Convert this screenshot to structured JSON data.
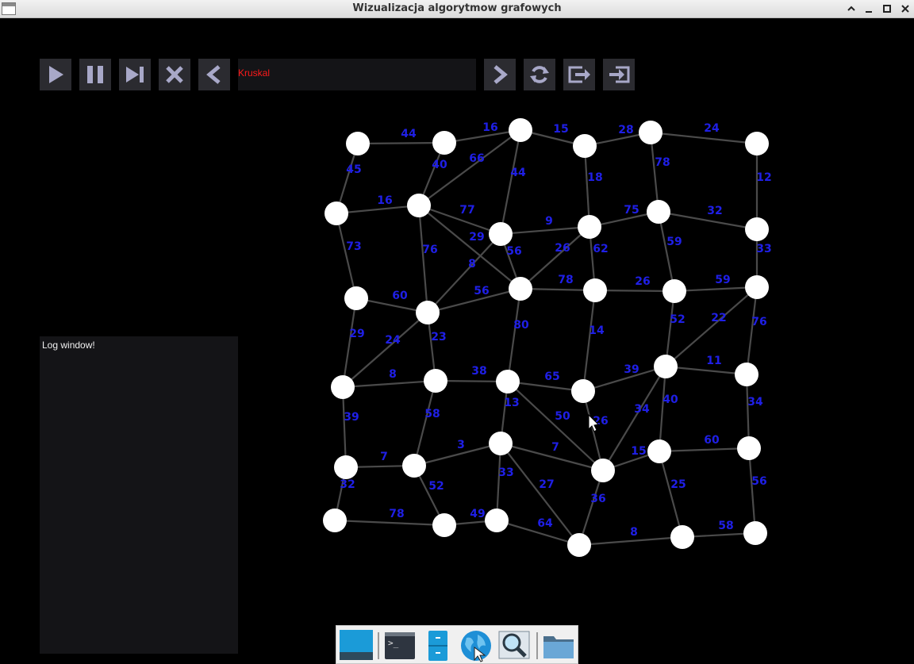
{
  "window": {
    "title": "Wizualizacja algorytmow grafowych"
  },
  "toolbar": {
    "buttons": [
      {
        "name": "play-button",
        "icon": "play-icon"
      },
      {
        "name": "pause-button",
        "icon": "pause-icon"
      },
      {
        "name": "step-button",
        "icon": "skip-next-icon"
      },
      {
        "name": "clear-button",
        "icon": "close-icon"
      },
      {
        "name": "prev-algorithm-button",
        "icon": "chevron-left-icon"
      },
      {
        "name": "next-algorithm-button",
        "icon": "chevron-right-icon"
      },
      {
        "name": "refresh-button",
        "icon": "refresh-icon"
      },
      {
        "name": "export-button",
        "icon": "export-icon"
      },
      {
        "name": "import-button",
        "icon": "import-icon"
      }
    ],
    "algorithm": "Kruskal",
    "algorithm_color": "#ff1a1a"
  },
  "log": {
    "text": "Log window!"
  },
  "graph": {
    "node_color": "#ffffff",
    "edge_color": "#4a4a4a",
    "label_color": "#1f1fe6",
    "weights": [
      "44",
      "16",
      "15",
      "28",
      "24",
      "45",
      "40",
      "66",
      "44",
      "18",
      "78",
      "12",
      "16",
      "77",
      "9",
      "75",
      "32",
      "73",
      "76",
      "29",
      "8",
      "56",
      "26",
      "62",
      "59",
      "33",
      "60",
      "56",
      "78",
      "26",
      "59",
      "29",
      "24",
      "23",
      "80",
      "14",
      "52",
      "22",
      "76",
      "8",
      "38",
      "65",
      "39",
      "11",
      "39",
      "58",
      "13",
      "50",
      "26",
      "34",
      "40",
      "34",
      "7",
      "3",
      "7",
      "15",
      "60",
      "32",
      "52",
      "33",
      "27",
      "36",
      "25",
      "56",
      "78",
      "49",
      "64",
      "8",
      "58"
    ]
  },
  "taskbar": {
    "apps": [
      {
        "name": "taskbar-desktop",
        "icon": "desktop-icon"
      },
      {
        "name": "taskbar-terminal",
        "icon": "terminal-icon"
      },
      {
        "name": "taskbar-file-cabinet",
        "icon": "file-cabinet-icon"
      },
      {
        "name": "taskbar-browser",
        "icon": "globe-icon"
      },
      {
        "name": "taskbar-search",
        "icon": "magnifier-icon"
      },
      {
        "name": "taskbar-folder",
        "icon": "folder-icon"
      }
    ]
  }
}
